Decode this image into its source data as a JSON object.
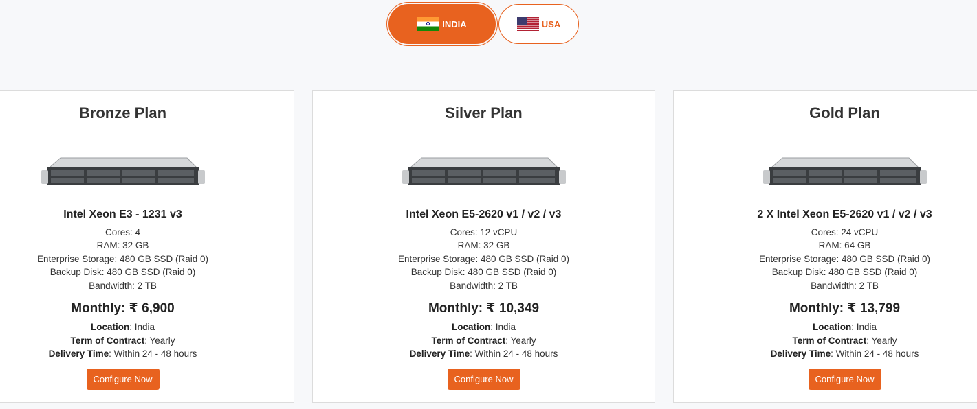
{
  "region_tabs": [
    {
      "label": "INDIA",
      "active": true,
      "flag_icon": "india-flag-icon"
    },
    {
      "label": "USA",
      "active": false,
      "flag_icon": "usa-flag-icon"
    }
  ],
  "accent_color": "#e8621f",
  "labels": {
    "location": "Location",
    "term": "Term of Contract",
    "delivery": "Delivery Time",
    "cta": "Configure Now"
  },
  "plans": [
    {
      "name": "Bronze Plan",
      "cpu": "Intel Xeon E3 - 1231 v3",
      "specs": [
        "Cores: 4",
        "RAM: 32 GB",
        "Enterprise Storage: 480 GB SSD (Raid 0)",
        "Backup Disk: 480 GB SSD (Raid 0)",
        "Bandwidth: 2 TB"
      ],
      "price": "Monthly: ₹ 6,900",
      "location": ": India",
      "term": ": Yearly",
      "delivery": ": Within 24 - 48 hours"
    },
    {
      "name": "Silver Plan",
      "cpu": "Intel Xeon E5-2620 v1 / v2 / v3",
      "specs": [
        "Cores: 12 vCPU",
        "RAM: 32 GB",
        "Enterprise Storage: 480 GB SSD (Raid 0)",
        "Backup Disk: 480 GB SSD (Raid 0)",
        "Bandwidth: 2 TB"
      ],
      "price": "Monthly: ₹ 10,349",
      "location": ": India",
      "term": ": Yearly",
      "delivery": ": Within 24 - 48 hours"
    },
    {
      "name": "Gold Plan",
      "cpu": "2 X Intel Xeon E5-2620 v1 / v2 / v3",
      "specs": [
        "Cores: 24 vCPU",
        "RAM: 64 GB",
        "Enterprise Storage: 480 GB SSD (Raid 0)",
        "Backup Disk: 480 GB SSD (Raid 0)",
        "Bandwidth: 2 TB"
      ],
      "price": "Monthly: ₹ 13,799",
      "location": ": India",
      "term": ": Yearly",
      "delivery": ": Within 24 - 48 hours"
    }
  ]
}
